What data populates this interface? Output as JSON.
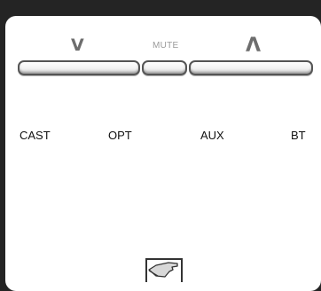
{
  "volume": {
    "down_label": "V",
    "mute_label": "MUTE",
    "up_label": "Λ"
  },
  "sources": {
    "cast": "CAST",
    "opt": "OPT",
    "aux": "AUX",
    "bt": "BT"
  },
  "bottom_icon": "hand-pointer-icon",
  "colors": {
    "background": "#242424",
    "panel": "#ffffff",
    "volume_label": "#6d6d6d",
    "mute_label": "#9a9a9a",
    "source_text": "#111111"
  }
}
